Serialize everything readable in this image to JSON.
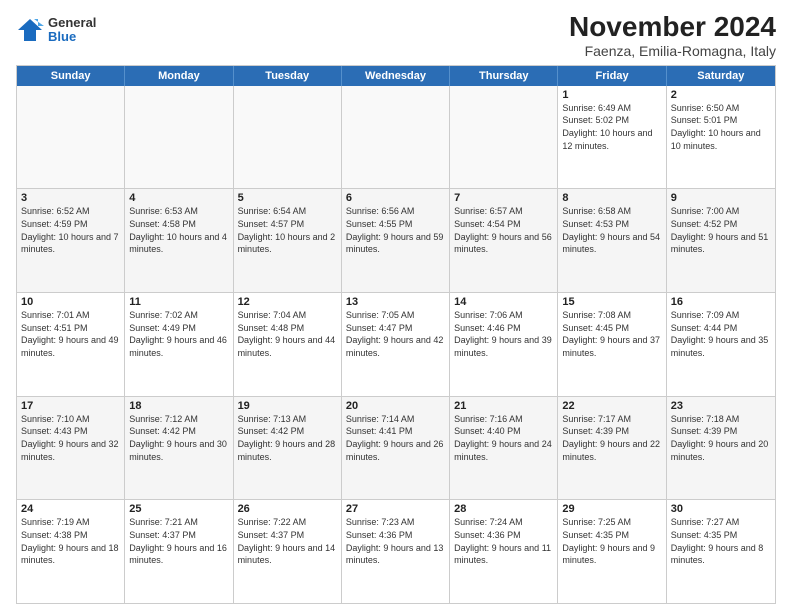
{
  "logo": {
    "general": "General",
    "blue": "Blue"
  },
  "header": {
    "month": "November 2024",
    "location": "Faenza, Emilia-Romagna, Italy"
  },
  "days": [
    "Sunday",
    "Monday",
    "Tuesday",
    "Wednesday",
    "Thursday",
    "Friday",
    "Saturday"
  ],
  "rows": [
    [
      {
        "day": "",
        "info": ""
      },
      {
        "day": "",
        "info": ""
      },
      {
        "day": "",
        "info": ""
      },
      {
        "day": "",
        "info": ""
      },
      {
        "day": "",
        "info": ""
      },
      {
        "day": "1",
        "info": "Sunrise: 6:49 AM\nSunset: 5:02 PM\nDaylight: 10 hours and 12 minutes."
      },
      {
        "day": "2",
        "info": "Sunrise: 6:50 AM\nSunset: 5:01 PM\nDaylight: 10 hours and 10 minutes."
      }
    ],
    [
      {
        "day": "3",
        "info": "Sunrise: 6:52 AM\nSunset: 4:59 PM\nDaylight: 10 hours and 7 minutes."
      },
      {
        "day": "4",
        "info": "Sunrise: 6:53 AM\nSunset: 4:58 PM\nDaylight: 10 hours and 4 minutes."
      },
      {
        "day": "5",
        "info": "Sunrise: 6:54 AM\nSunset: 4:57 PM\nDaylight: 10 hours and 2 minutes."
      },
      {
        "day": "6",
        "info": "Sunrise: 6:56 AM\nSunset: 4:55 PM\nDaylight: 9 hours and 59 minutes."
      },
      {
        "day": "7",
        "info": "Sunrise: 6:57 AM\nSunset: 4:54 PM\nDaylight: 9 hours and 56 minutes."
      },
      {
        "day": "8",
        "info": "Sunrise: 6:58 AM\nSunset: 4:53 PM\nDaylight: 9 hours and 54 minutes."
      },
      {
        "day": "9",
        "info": "Sunrise: 7:00 AM\nSunset: 4:52 PM\nDaylight: 9 hours and 51 minutes."
      }
    ],
    [
      {
        "day": "10",
        "info": "Sunrise: 7:01 AM\nSunset: 4:51 PM\nDaylight: 9 hours and 49 minutes."
      },
      {
        "day": "11",
        "info": "Sunrise: 7:02 AM\nSunset: 4:49 PM\nDaylight: 9 hours and 46 minutes."
      },
      {
        "day": "12",
        "info": "Sunrise: 7:04 AM\nSunset: 4:48 PM\nDaylight: 9 hours and 44 minutes."
      },
      {
        "day": "13",
        "info": "Sunrise: 7:05 AM\nSunset: 4:47 PM\nDaylight: 9 hours and 42 minutes."
      },
      {
        "day": "14",
        "info": "Sunrise: 7:06 AM\nSunset: 4:46 PM\nDaylight: 9 hours and 39 minutes."
      },
      {
        "day": "15",
        "info": "Sunrise: 7:08 AM\nSunset: 4:45 PM\nDaylight: 9 hours and 37 minutes."
      },
      {
        "day": "16",
        "info": "Sunrise: 7:09 AM\nSunset: 4:44 PM\nDaylight: 9 hours and 35 minutes."
      }
    ],
    [
      {
        "day": "17",
        "info": "Sunrise: 7:10 AM\nSunset: 4:43 PM\nDaylight: 9 hours and 32 minutes."
      },
      {
        "day": "18",
        "info": "Sunrise: 7:12 AM\nSunset: 4:42 PM\nDaylight: 9 hours and 30 minutes."
      },
      {
        "day": "19",
        "info": "Sunrise: 7:13 AM\nSunset: 4:42 PM\nDaylight: 9 hours and 28 minutes."
      },
      {
        "day": "20",
        "info": "Sunrise: 7:14 AM\nSunset: 4:41 PM\nDaylight: 9 hours and 26 minutes."
      },
      {
        "day": "21",
        "info": "Sunrise: 7:16 AM\nSunset: 4:40 PM\nDaylight: 9 hours and 24 minutes."
      },
      {
        "day": "22",
        "info": "Sunrise: 7:17 AM\nSunset: 4:39 PM\nDaylight: 9 hours and 22 minutes."
      },
      {
        "day": "23",
        "info": "Sunrise: 7:18 AM\nSunset: 4:39 PM\nDaylight: 9 hours and 20 minutes."
      }
    ],
    [
      {
        "day": "24",
        "info": "Sunrise: 7:19 AM\nSunset: 4:38 PM\nDaylight: 9 hours and 18 minutes."
      },
      {
        "day": "25",
        "info": "Sunrise: 7:21 AM\nSunset: 4:37 PM\nDaylight: 9 hours and 16 minutes."
      },
      {
        "day": "26",
        "info": "Sunrise: 7:22 AM\nSunset: 4:37 PM\nDaylight: 9 hours and 14 minutes."
      },
      {
        "day": "27",
        "info": "Sunrise: 7:23 AM\nSunset: 4:36 PM\nDaylight: 9 hours and 13 minutes."
      },
      {
        "day": "28",
        "info": "Sunrise: 7:24 AM\nSunset: 4:36 PM\nDaylight: 9 hours and 11 minutes."
      },
      {
        "day": "29",
        "info": "Sunrise: 7:25 AM\nSunset: 4:35 PM\nDaylight: 9 hours and 9 minutes."
      },
      {
        "day": "30",
        "info": "Sunrise: 7:27 AM\nSunset: 4:35 PM\nDaylight: 9 hours and 8 minutes."
      }
    ]
  ]
}
